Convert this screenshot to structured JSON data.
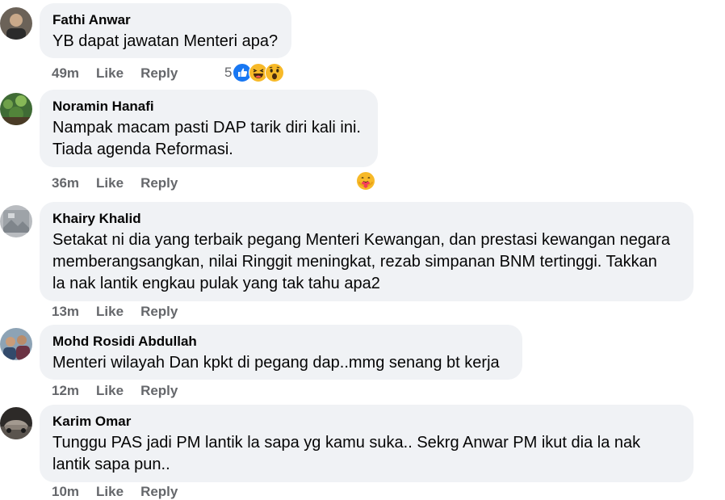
{
  "comments": [
    {
      "author": "Fathi Anwar",
      "lines": [
        "YB dapat jawatan Menteri apa?"
      ],
      "time": "49m",
      "like": "Like",
      "reply": "Reply",
      "reaction_count": "5",
      "reactions": [
        "like-icon",
        "laugh-icon",
        "wow-icon"
      ]
    },
    {
      "author": "Noramin Hanafi",
      "lines": [
        "Nampak macam pasti DAP tarik diri kali ini.",
        "Tiada agenda Reformasi."
      ],
      "time": "36m",
      "like": "Like",
      "reply": "Reply",
      "reactions": [
        "care-icon"
      ]
    },
    {
      "author": "Khairy Khalid",
      "lines": [
        "Setakat ni dia yang terbaik pegang Menteri Kewangan, dan prestasi kewangan negara",
        "memberangsangkan, nilai Ringgit meningkat, rezab simpanan BNM tertinggi. Takkan",
        "la nak lantik engkau pulak yang tak tahu apa2"
      ],
      "time": "13m",
      "like": "Like",
      "reply": "Reply"
    },
    {
      "author": "Mohd Rosidi Abdullah",
      "lines": [
        "Menteri wilayah Dan kpkt di pegang dap..mmg senang bt kerja"
      ],
      "time": "12m",
      "like": "Like",
      "reply": "Reply"
    },
    {
      "author": "Karim Omar",
      "lines": [
        "Tunggu PAS jadi PM lantik la sapa yg kamu suka.. Sekrg Anwar PM ikut dia la nak",
        "lantik sapa pun.."
      ],
      "time": "10m",
      "like": "Like",
      "reply": "Reply"
    }
  ],
  "colors": {
    "bubble": "#f0f2f5",
    "meta": "#65676b",
    "text": "#050505",
    "like_blue": "#1877f2"
  }
}
